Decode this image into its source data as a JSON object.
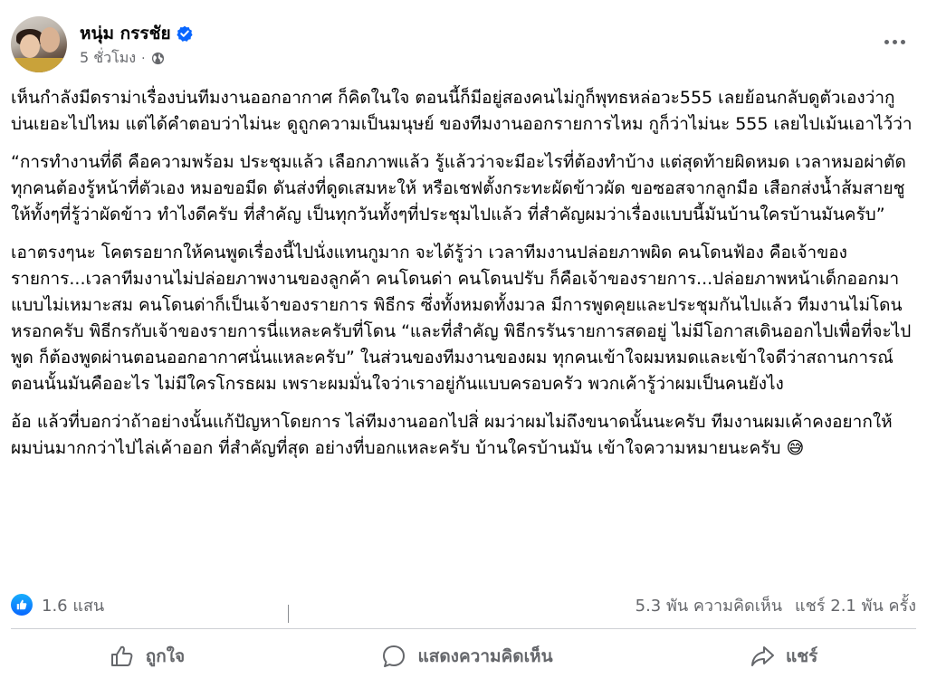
{
  "post": {
    "author": "หนุ่ม กรรชัย",
    "time": "5 ชั่วโมง",
    "separator": "·",
    "paragraphs": [
      "เห็นกำลังมีดราม่าเรื่องบ่นทีมงานออกอากาศ ก็คิดในใจ ตอนนี้ก็มีอยู่สองคนไม่กูก็พุทธหล่อวะ555 เลยย้อนกลับดูตัวเองว่ากูบ่นเยอะไปไหม แต่ได้คำตอบว่าไม่นะ ดูถูกความเป็นมนุษย์ ของทีมงานออกรายการไหม กูก็ว่าไม่นะ 555 เลยไปเม้นเอาไว้ว่า",
      "“การทำงานที่ดี คือความพร้อม ประชุมแล้ว เลือกภาพแล้ว รู้แล้วว่าจะมีอะไรที่ต้องทำบ้าง แต่สุดท้ายผิดหมด เวลาหมอผ่าตัดทุกคนต้องรู้หน้าที่ตัวเอง หมอขอมีด ดันส่งที่ดูดเสมหะให้ หรือเชฟตั้งกระทะผัดข้าวผัด ขอซอสจากลูกมือ เสือกส่งน้ำส้มสายชูให้ทั้งๆที่รู้ว่าผัดข้าว ทำไงดีครับ ที่สำคัญ เป็นทุกวันทั้งๆที่ประชุมไปแล้ว ที่สำคัญผมว่าเรื่องแบบนี้มันบ้านใครบ้านมันครับ”",
      "เอาตรงๆนะ โคตรอยากให้คนพูดเรื่องนี้ไปนั่งแทนกูมาก จะได้รู้ว่า เวลาทีมงานปล่อยภาพผิด คนโดนฟ้อง คือเจ้าของรายการ...เวลาทีมงานไม่ปล่อยภาพงานของลูกค้า คนโดนด่า คนโดนปรับ ก็คือเจ้าของรายการ...ปล่อยภาพหน้าเด็กออกมาแบบไม่เหมาะสม คนโดนด่าก็เป็นเจ้าของรายการ พิธีกร   ซึ่งทั้งหมดทั้งมวล มีการพูดคุยและประชุมกันไปแล้ว ทีมงานไม่โดนหรอกครับ พิธีกรกับเจ้าของรายการนี่แหละครับที่โดน “และที่สำคัญ พิธีกรรันรายการสดอยู่ ไม่มีโอกาสเดินออกไปเพื่อที่จะไปพูด ก็ต้องพูดผ่านตอนออกอากาศนั่นแหละครับ” ในส่วนของทีมงานของผม ทุกคนเข้าใจผมหมดและเข้าใจดีว่าสถานการณ์ตอนนั้นมันคืออะไร ไม่มีใครโกรธผม เพราะผมมั่นใจว่าเราอยู่กันแบบครอบครัว พวกเค้ารู้ว่าผมเป็นคนยังไง",
      "อ้อ  แล้วที่บอกว่าถ้าอย่างนั้นแก้ปัญหาโดยการ ไล่ทีมงานออกไปสิ่ ผมว่าผมไม่ถึงขนาดนั้นนะครับ ทีมงานผมเค้าคงอยากให้ผมบ่นมากกว่าไปไล่เค้าออก ที่สำคัญที่สุด อย่างที่บอกแหละครับ บ้านใครบ้านมัน เข้าใจความหมายนะครับ 😅"
    ]
  },
  "stats": {
    "reactions": "1.6 แสน",
    "comments": "5.3 พัน ความคิดเห็น",
    "shares": "แชร์ 2.1 พัน ครั้ง"
  },
  "actions": {
    "like": "ถูกใจ",
    "comment": "แสดงความคิดเห็น",
    "share": "แชร์"
  },
  "colors": {
    "accent": "#0866ff",
    "muted": "#65676b",
    "text": "#050505"
  },
  "icons": {
    "verified": "verified-badge-icon",
    "privacy": "globe-icon",
    "more": "more-options-icon",
    "reaction": "like-reaction-icon",
    "like": "thumbs-up-icon",
    "comment": "comment-bubble-icon",
    "share": "share-arrow-icon"
  }
}
